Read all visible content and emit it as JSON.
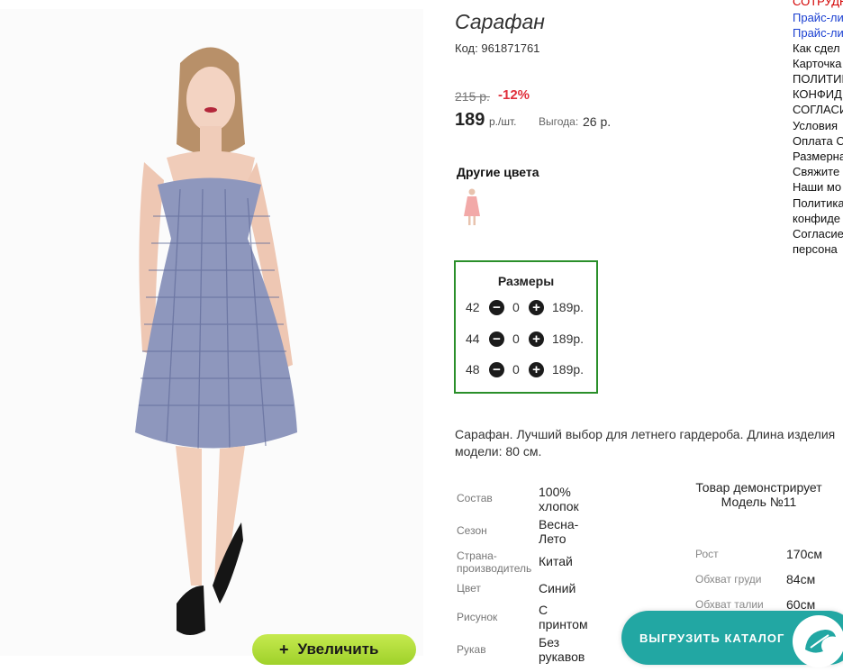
{
  "product": {
    "title": "Сарафан",
    "code_label": "Код:",
    "code": "961871761",
    "old_price": "215 р.",
    "discount": "-12%",
    "price": "189",
    "unit": "р./шт.",
    "benefit_label": "Выгода:",
    "benefit_value": "26 р."
  },
  "zoom_button": {
    "icon": "+",
    "label": "Увеличить"
  },
  "colors": {
    "title": "Другие цвета",
    "thumb_color": "#f2a9a8"
  },
  "sizes": {
    "title": "Размеры",
    "rows": [
      {
        "size": "42",
        "qty": "0",
        "price": "189р."
      },
      {
        "size": "44",
        "qty": "0",
        "price": "189р."
      },
      {
        "size": "48",
        "qty": "0",
        "price": "189р."
      }
    ]
  },
  "description": "Сарафан. Лучший выбор для летнего гардероба. Длина изделия модели: 80 см.",
  "attributes": [
    {
      "label": "Состав",
      "value": "100% хлопок"
    },
    {
      "label": "Сезон",
      "value": "Весна-Лето"
    },
    {
      "label": "Страна-производитель",
      "value": "Китай"
    },
    {
      "label": "Цвет",
      "value": "Синий"
    },
    {
      "label": "Рисунок",
      "value": "С принтом"
    },
    {
      "label": "Рукав",
      "value": "Без рукавов"
    }
  ],
  "model": {
    "title": "Товар демонстрирует Модель №11",
    "rows": [
      {
        "label": "Рост",
        "value": "170см"
      },
      {
        "label": "Обхват груди",
        "value": "84см"
      },
      {
        "label": "Обхват талии",
        "value": "60см"
      }
    ]
  },
  "sidebar": {
    "items": [
      "СОТРУДН",
      "Прайс-ли",
      "Прайс-ли",
      "Как сдел",
      "Карточка",
      "ПОЛИТИК",
      "КОНФИД",
      "СОГЛАСИ",
      "Условия",
      "Оплата С",
      "Размерна",
      "Свяжите",
      "Наши мо",
      "Политика",
      "конфиде",
      "Согласие",
      "персона"
    ]
  },
  "export_button": {
    "label": "ВЫГРУЗИТЬ КАТАЛОГ"
  },
  "colors_theme": {
    "accent_green": "#2a8f2a",
    "discount_red": "#e0303c",
    "export_teal": "#22a7a3",
    "zoom_green": "#9fd12a"
  }
}
